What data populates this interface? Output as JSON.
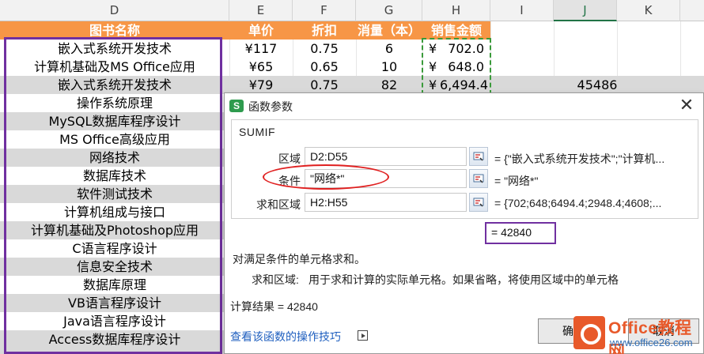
{
  "sheet": {
    "columns": [
      "D",
      "E",
      "F",
      "G",
      "H",
      "I",
      "J",
      "K"
    ],
    "selected_column": "J",
    "header": {
      "book_name": "图书名称",
      "unit_price": "单价",
      "discount": "折扣",
      "sales_qty": "消量（本）",
      "sales_amount": "销售金额"
    },
    "rows": [
      {
        "name": "嵌入式系统开发技术",
        "price": "¥117",
        "discount": "0.75",
        "qty": "6",
        "amount_symbol": "¥",
        "amount": "702.0",
        "j": ""
      },
      {
        "name": "计算机基础及MS Office应用",
        "price": "¥65",
        "discount": "0.65",
        "qty": "10",
        "amount_symbol": "¥",
        "amount": "648.0",
        "j": ""
      },
      {
        "name": "嵌入式系统开发技术",
        "price": "¥79",
        "discount": "0.75",
        "qty": "82",
        "amount_symbol": "¥",
        "amount": "6,494.4",
        "j": "45486"
      },
      {
        "name": "操作系统原理"
      },
      {
        "name": "MySQL数据库程序设计"
      },
      {
        "name": "MS Office高级应用"
      },
      {
        "name": "网络技术"
      },
      {
        "name": "数据库技术"
      },
      {
        "name": "软件测试技术"
      },
      {
        "name": "计算机组成与接口"
      },
      {
        "name": "计算机基础及Photoshop应用"
      },
      {
        "name": "C语言程序设计"
      },
      {
        "name": "信息安全技术"
      },
      {
        "name": "数据库原理"
      },
      {
        "name": "VB语言程序设计"
      },
      {
        "name": "Java语言程序设计"
      },
      {
        "name": "Access数据库程序设计"
      }
    ]
  },
  "dialog": {
    "title": "函数参数",
    "app_icon": "S",
    "close_glyph": "✕",
    "function_name": "SUMIF",
    "args": [
      {
        "label": "区域",
        "value": "D2:D55",
        "result": "= {\"嵌入式系统开发技术\";\"计算机..."
      },
      {
        "label": "条件",
        "value": "\"网络*\"",
        "result": "= \"网络*\""
      },
      {
        "label": "求和区域",
        "value": "H2:H55",
        "result": "= {702;648;6494.4;2948.4;4608;..."
      }
    ],
    "total": "= 42840",
    "description": "对满足条件的单元格求和。",
    "arg_help_label": "求和区域:",
    "arg_help_text": "用于求和计算的实际单元格。如果省略，将使用区域中的单元格",
    "calc_result_label": "计算结果 = 42840",
    "help_link": "查看该函数的操作技巧",
    "ok_label": "确",
    "cancel_label": "取消"
  },
  "watermark": {
    "brand": "Office教程网",
    "url": "www.office26.com"
  },
  "colors": {
    "header_orange": "#f79646",
    "alt_row_gray": "#d9d9d9",
    "highlight_purple": "#7030a0",
    "ellipse_red": "#e02020",
    "dash_green": "#3a9a3a",
    "link_blue": "#1f5fbf"
  },
  "icons": [
    "collapse-dialog-icon",
    "close-icon",
    "wps-app-icon",
    "play-help-icon"
  ]
}
